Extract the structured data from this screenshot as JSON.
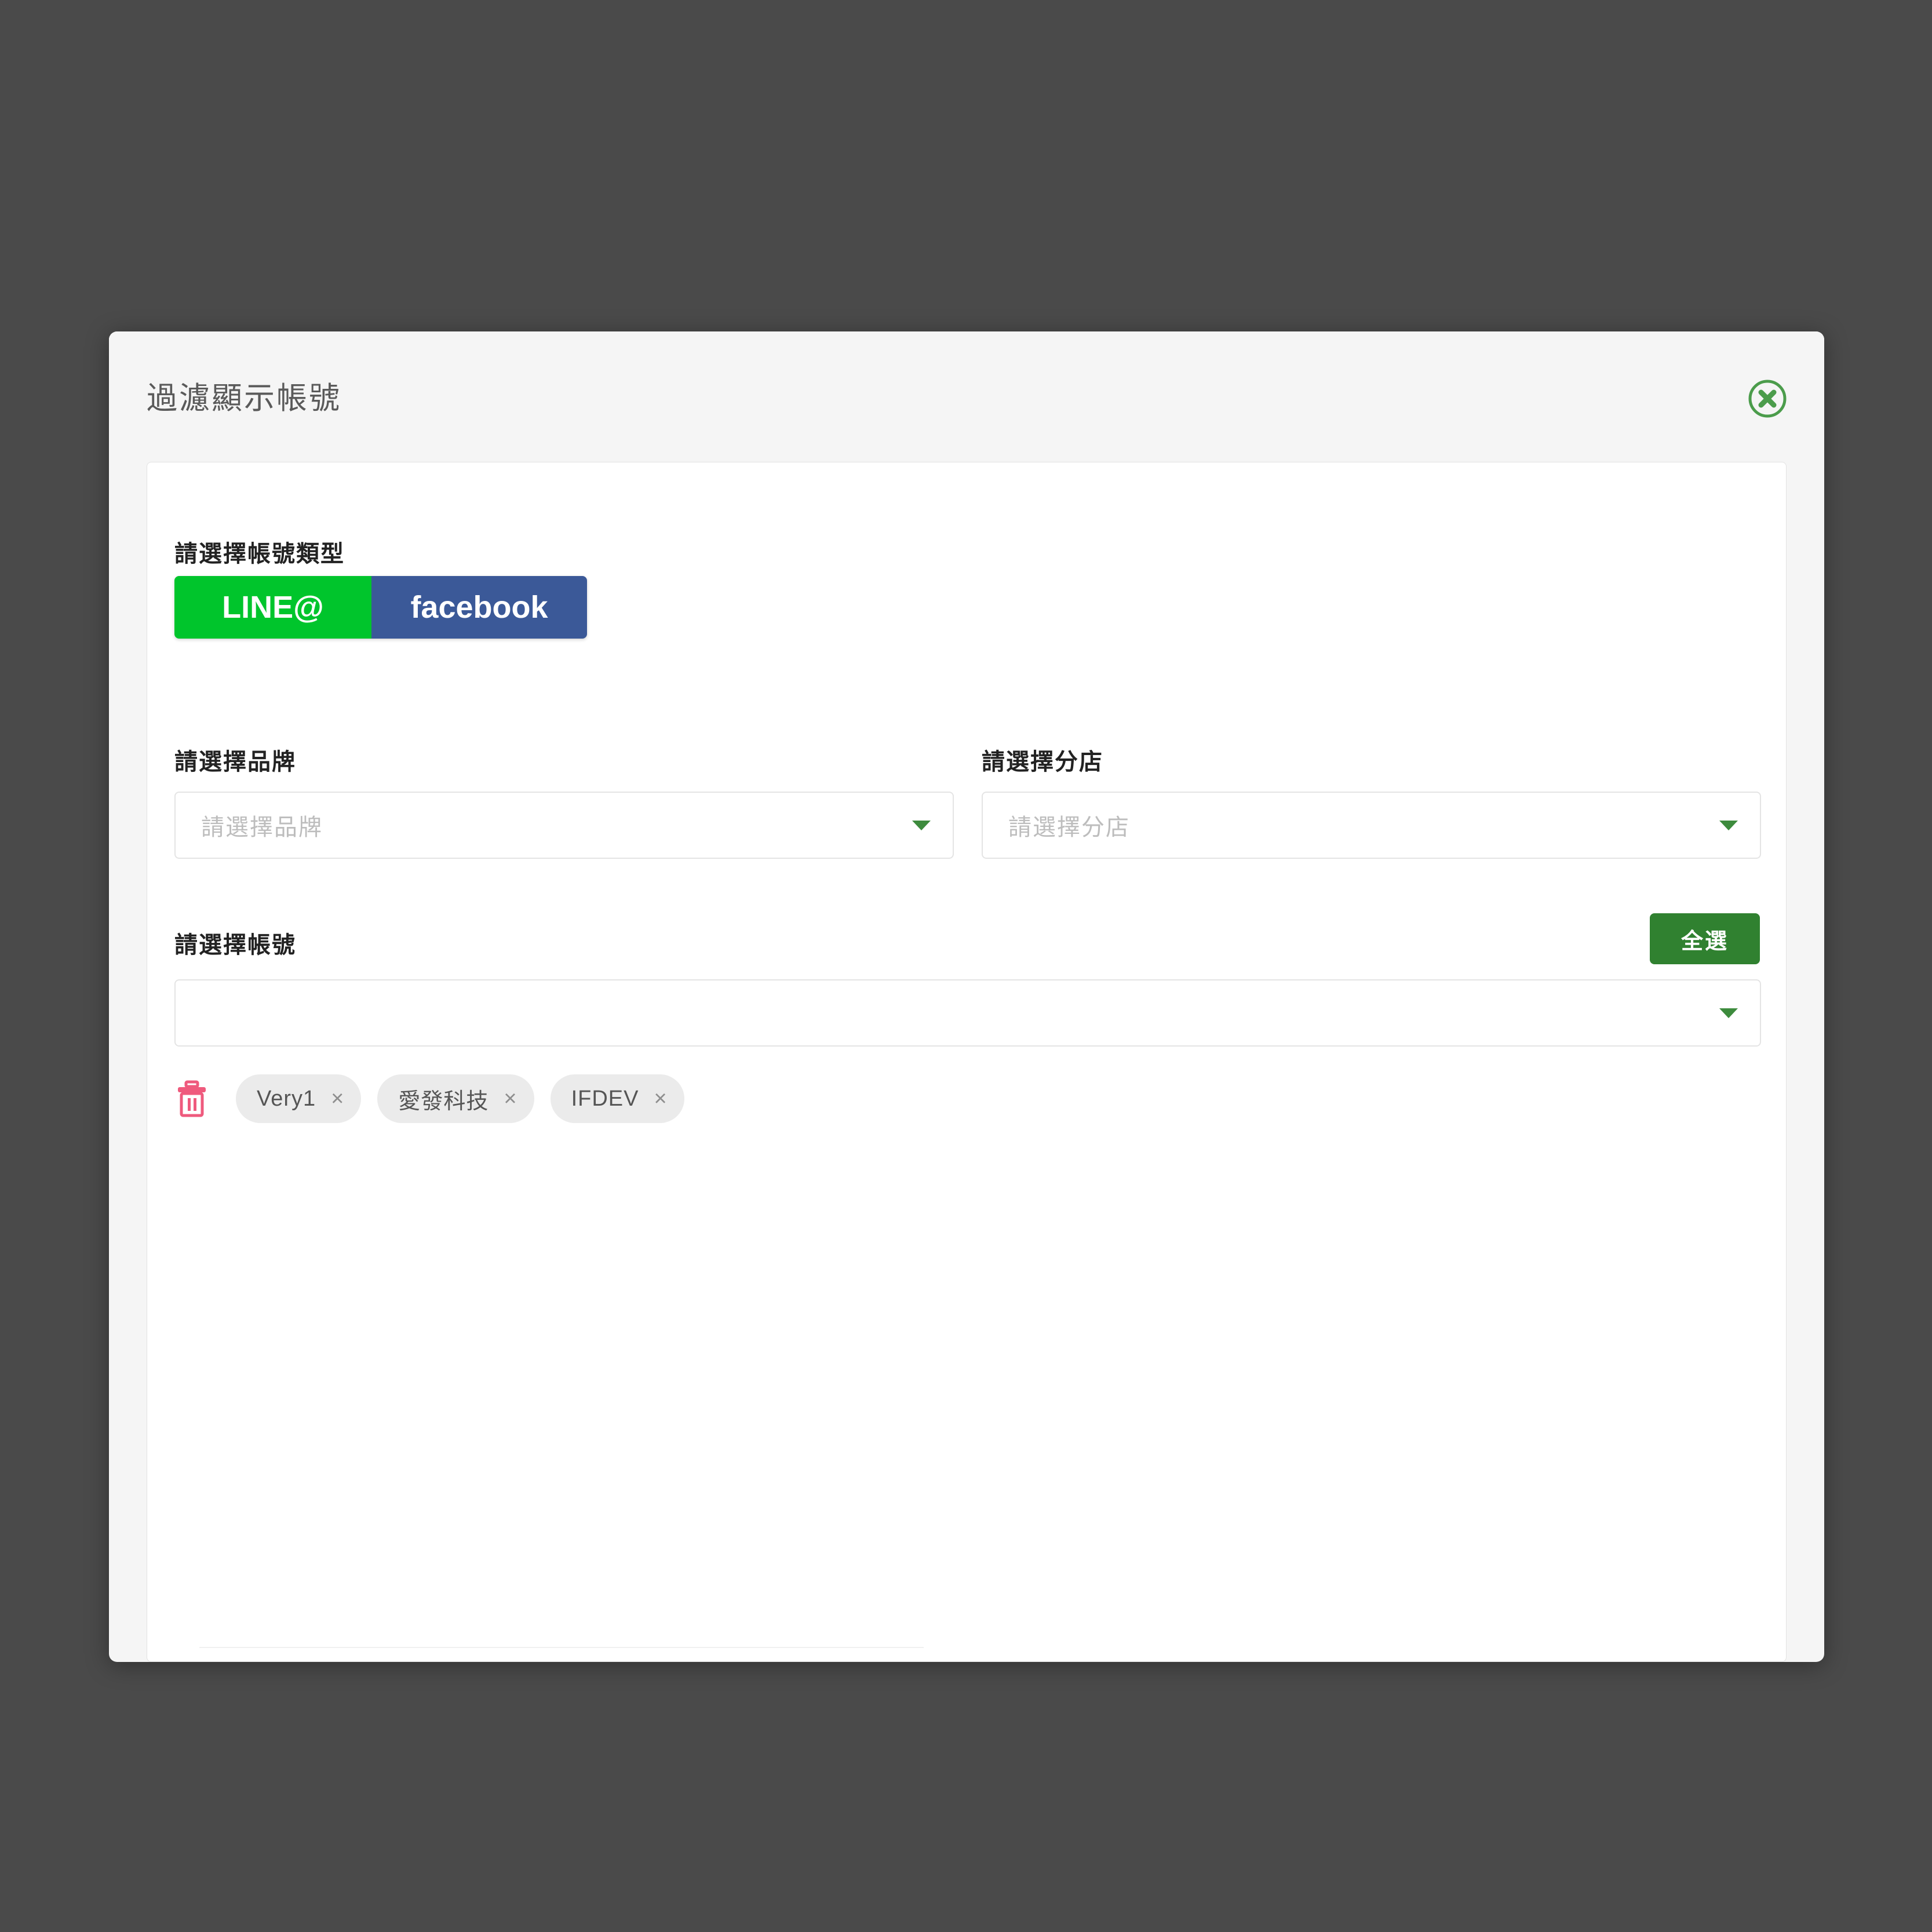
{
  "overlay": {
    "color": "#4a4a4a"
  },
  "modal": {
    "title": "過濾顯示帳號",
    "close_label": "×"
  },
  "form": {
    "account_type": {
      "label": "請選擇帳號類型",
      "options": [
        {
          "label": "LINE@",
          "color": "#00c52c"
        },
        {
          "label": "facebook",
          "color": "#3b5998"
        }
      ]
    },
    "brand": {
      "label": "請選擇品牌",
      "value": "",
      "placeholder": "請選擇品牌"
    },
    "branch": {
      "label": "請選擇分店",
      "value": "",
      "placeholder": "請選擇分店"
    },
    "account": {
      "label": "請選擇帳號",
      "select_all_label": "全選",
      "value": "",
      "placeholder": ""
    },
    "selected_tags": [
      {
        "label": "Very1",
        "remove_label": "×"
      },
      {
        "label": "愛發科技",
        "remove_label": "×"
      },
      {
        "label": "IFDEV",
        "remove_label": "×"
      }
    ]
  },
  "colors": {
    "accent_green": "#308130",
    "line_green": "#00c52c",
    "facebook_blue": "#3b5998",
    "trash_pink": "#ef5a7d",
    "caret_green": "#3d8b3d",
    "tag_bg": "#ebebeb",
    "placeholder": "#bdbdbd"
  }
}
